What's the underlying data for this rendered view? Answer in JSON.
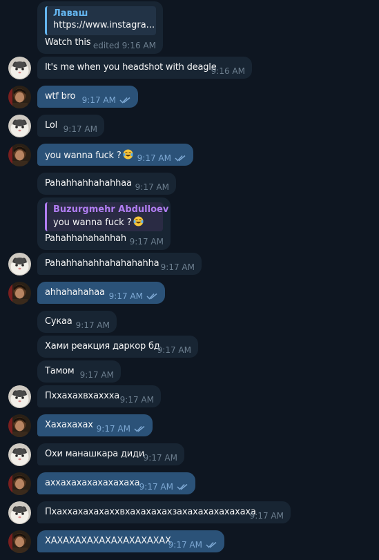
{
  "messages": [
    {
      "id": "m1",
      "side": "in",
      "reply": {
        "name": "Лаваш",
        "text": "https://www.instagra..."
      },
      "text": "Watch this",
      "time": "edited 9:16 AM"
    },
    {
      "id": "m2",
      "side": "in",
      "avatar": "cat",
      "text": "It's me when you headshot with deagle",
      "time": "9:16 AM"
    },
    {
      "id": "m3",
      "side": "out",
      "avatar": "user",
      "text": "wtf bro",
      "time": "9:17 AM",
      "read": true
    },
    {
      "id": "m4",
      "side": "in",
      "avatar": "cat",
      "text": "Lol",
      "time": "9:17 AM"
    },
    {
      "id": "m5",
      "side": "out",
      "avatar": "user",
      "text": "you wanna fuck ?",
      "emoji": "laughing-crying-emoji",
      "time": "9:17 AM",
      "read": true
    },
    {
      "id": "m6",
      "side": "in",
      "text": "Pahahhahhahahhaa",
      "time": "9:17 AM"
    },
    {
      "id": "m7",
      "side": "in",
      "reply": {
        "name": "Buzurgmehr Abdulloev",
        "text": "you wanna fuck ?",
        "emoji": "laughing-crying-emoji"
      },
      "text": "Pahahhahahahhah",
      "time": "9:17 AM"
    },
    {
      "id": "m8",
      "side": "in",
      "avatar": "cat",
      "text": "Pahahhahahhahahahahha",
      "time": "9:17 AM"
    },
    {
      "id": "m9",
      "side": "out",
      "avatar": "user",
      "text": "ahhahahahaa",
      "time": "9:17 AM",
      "read": true
    },
    {
      "id": "m10",
      "side": "in",
      "text": "Сукаа",
      "time": "9:17 AM"
    },
    {
      "id": "m11",
      "side": "in",
      "text": "Хами реакция даркор бд",
      "time": "9:17 AM"
    },
    {
      "id": "m12",
      "side": "in",
      "text": "Тамом",
      "time": "9:17 AM"
    },
    {
      "id": "m13",
      "side": "in",
      "avatar": "cat",
      "text": "Пхxахахвхахххa",
      "time": "9:17 AM"
    },
    {
      "id": "m14",
      "side": "out",
      "avatar": "user",
      "text": "Хахахахах",
      "time": "9:17 AM",
      "read": true
    },
    {
      "id": "m15",
      "side": "in",
      "avatar": "cat",
      "text": "Охи манашкара диди",
      "time": "9:17 AM"
    },
    {
      "id": "m16",
      "side": "out",
      "avatar": "user",
      "text": "аххахахахахахахаха",
      "time": "9:17 AM",
      "read": true
    },
    {
      "id": "m17",
      "side": "in",
      "avatar": "cat",
      "text": "Пхаххахахахаххвхахахахахзахахахахахахаха",
      "time": "9:17 AM"
    },
    {
      "id": "m18",
      "side": "out",
      "avatar": "user",
      "text": "ХАХАХАХАХАХАХАХАХАХАХ",
      "time": "9:17 AM",
      "read": true
    }
  ]
}
